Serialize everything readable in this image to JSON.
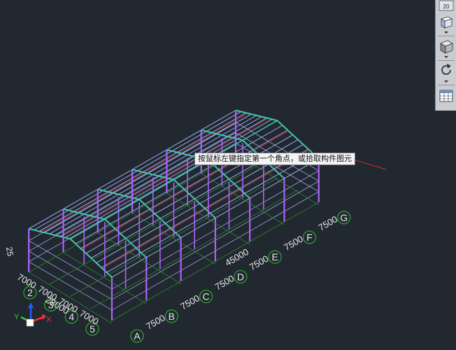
{
  "toolbar": {
    "viewcube_number": "20",
    "items": [
      "viewcube-widget",
      "view-cube-dropdown",
      "3d-box-view",
      "orbit-refresh",
      "properties-panel"
    ]
  },
  "tooltip": {
    "text": "按鼠标左键指定第一个角点，或拾取构件图元"
  },
  "grid": {
    "letter_axes": [
      "A",
      "B",
      "C",
      "D",
      "E",
      "F",
      "G"
    ],
    "number_axes": [
      "2",
      "3",
      "4",
      "5"
    ],
    "bay_dims_front": [
      "7500",
      "7500",
      "7500",
      "7500",
      "7500",
      "7500"
    ],
    "total_dim_front": "45000",
    "bay_dims_side": [
      "7000",
      "7000",
      "7000",
      "7000"
    ],
    "total_dim_side": "28000",
    "partial_label": "25"
  },
  "ucs": {
    "x_label": "X",
    "y_label": "Y"
  },
  "colors": {
    "background": "#212830",
    "frame_column": "#b060ff",
    "purlin": "#a8b8ff",
    "rafter": "#40c8a8",
    "brace": "#d03030",
    "grid_text": "#e8e8e8",
    "bubble": "#2ea02e"
  }
}
